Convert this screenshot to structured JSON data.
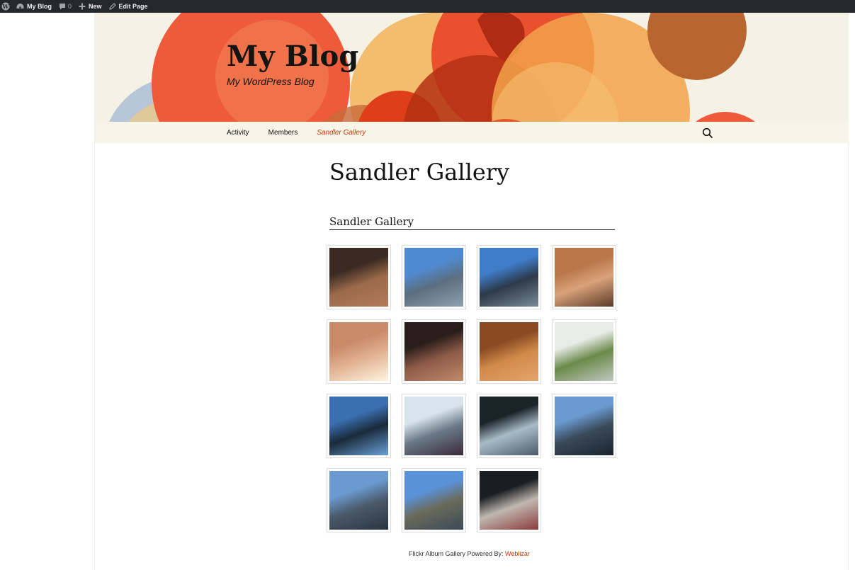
{
  "adminbar": {
    "site_name": "My Blog",
    "comments_count": "0",
    "new_label": "New",
    "edit_label": "Edit Page",
    "icons": [
      "wordpress-logo-icon",
      "dashboard-icon",
      "comment-icon",
      "plus-icon",
      "pencil-icon"
    ]
  },
  "header": {
    "title": "My Blog",
    "description": "My WordPress Blog"
  },
  "nav": {
    "items": [
      {
        "label": "Activity",
        "current": false
      },
      {
        "label": "Members",
        "current": false
      },
      {
        "label": "Sandler Gallery",
        "current": true
      }
    ],
    "search_icon": "search-icon"
  },
  "page": {
    "title": "Sandler Gallery"
  },
  "gallery": {
    "heading": "Sandler Gallery",
    "photos": [
      {
        "subject": "concert hall seating from balcony",
        "colors": [
          "#3a2a22",
          "#9a6a4a",
          "#b47a5a"
        ]
      },
      {
        "subject": "glass building facade with blue sky",
        "colors": [
          "#4f8ad0",
          "#5c6e80",
          "#8ea0b0"
        ]
      },
      {
        "subject": "modern building corner with blue sky",
        "colors": [
          "#3f7cc8",
          "#2c3a4a",
          "#7a8a98"
        ]
      },
      {
        "subject": "curved balcony rows with person",
        "colors": [
          "#b9774a",
          "#d9a27a",
          "#5a3a28"
        ]
      },
      {
        "subject": "curved theater seats close-up",
        "colors": [
          "#c98a6a",
          "#e0b090",
          "#fff4e0"
        ]
      },
      {
        "subject": "concert hall interior aisle view",
        "colors": [
          "#2a1e1a",
          "#8c5a48",
          "#c08a6a"
        ]
      },
      {
        "subject": "stage with wooden walls",
        "colors": [
          "#8a4a22",
          "#d08a4a",
          "#e6a46a"
        ]
      },
      {
        "subject": "flower arrangement in vase",
        "colors": [
          "#e8ece8",
          "#6a8a4a",
          "#c0c8c0"
        ]
      },
      {
        "subject": "lobby window with hanging lamp",
        "colors": [
          "#3a70b0",
          "#1a2a3a",
          "#6aa0d8"
        ]
      },
      {
        "subject": "bright lobby with glass walls",
        "colors": [
          "#d8e4ec",
          "#6a7a88",
          "#3a2a3a"
        ]
      },
      {
        "subject": "dark lobby with glass walls",
        "colors": [
          "#1a2428",
          "#a8bcc8",
          "#4a5a68"
        ]
      },
      {
        "subject": "building exterior at dusk",
        "colors": [
          "#6a9ad0",
          "#3a4a5a",
          "#1a2430"
        ]
      },
      {
        "subject": "glass building exterior wide",
        "colors": [
          "#6a9ad0",
          "#4a5a6a",
          "#2a3440"
        ]
      },
      {
        "subject": "building with bare trees and lamp",
        "colors": [
          "#5a92d8",
          "#6a6a5a",
          "#3a4a58"
        ]
      },
      {
        "subject": "person holding bag near window",
        "colors": [
          "#1a1e22",
          "#c0b8b0",
          "#8a3a3a"
        ]
      }
    ]
  },
  "footer": {
    "credit_text": "Flickr Album Gallery Powered By: ",
    "credit_link": "Weblizar"
  },
  "colors": {
    "adminbar_bg": "#23282d",
    "header_bg": "#f5f1e4",
    "nav_bg": "#f7f5e7",
    "accent": "#bc360a",
    "text": "#141412"
  }
}
